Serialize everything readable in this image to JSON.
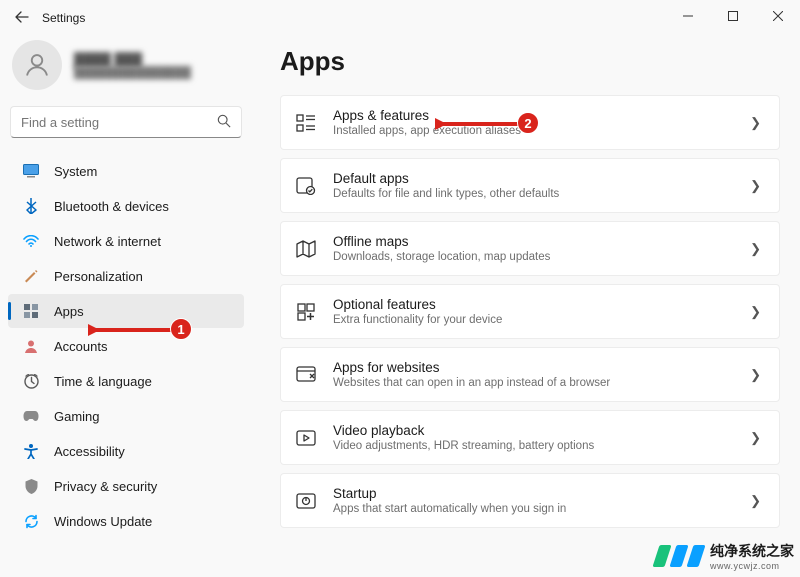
{
  "window": {
    "title": "Settings"
  },
  "account": {
    "name": "████ ███",
    "email": "███████████████"
  },
  "search": {
    "placeholder": "Find a setting"
  },
  "sidebar": {
    "items": [
      {
        "label": "System",
        "icon": "system",
        "color": "#0067c0"
      },
      {
        "label": "Bluetooth & devices",
        "icon": "bluetooth",
        "color": "#0067c0"
      },
      {
        "label": "Network & internet",
        "icon": "network",
        "color": "#0aa0ff"
      },
      {
        "label": "Personalization",
        "icon": "personalization",
        "color": "#c98a55"
      },
      {
        "label": "Apps",
        "icon": "apps",
        "color": "#4a5560",
        "selected": true
      },
      {
        "label": "Accounts",
        "icon": "accounts",
        "color": "#c75050"
      },
      {
        "label": "Time & language",
        "icon": "time",
        "color": "#5a5a5a"
      },
      {
        "label": "Gaming",
        "icon": "gaming",
        "color": "#7a7a7a"
      },
      {
        "label": "Accessibility",
        "icon": "accessibility",
        "color": "#0067c0"
      },
      {
        "label": "Privacy & security",
        "icon": "privacy",
        "color": "#6e6e6e"
      },
      {
        "label": "Windows Update",
        "icon": "update",
        "color": "#0aa0ff"
      }
    ]
  },
  "page": {
    "title": "Apps",
    "cards": [
      {
        "title": "Apps & features",
        "desc": "Installed apps, app execution aliases",
        "icon": "apps-features"
      },
      {
        "title": "Default apps",
        "desc": "Defaults for file and link types, other defaults",
        "icon": "default-apps"
      },
      {
        "title": "Offline maps",
        "desc": "Downloads, storage location, map updates",
        "icon": "offline-maps"
      },
      {
        "title": "Optional features",
        "desc": "Extra functionality for your device",
        "icon": "optional-features"
      },
      {
        "title": "Apps for websites",
        "desc": "Websites that can open in an app instead of a browser",
        "icon": "apps-websites"
      },
      {
        "title": "Video playback",
        "desc": "Video adjustments, HDR streaming, battery options",
        "icon": "video-playback"
      },
      {
        "title": "Startup",
        "desc": "Apps that start automatically when you sign in",
        "icon": "startup"
      }
    ]
  },
  "annotations": {
    "badge1": "1",
    "badge2": "2"
  },
  "watermark": {
    "text": "纯净系统之家",
    "url": "www.ycwjz.com"
  }
}
